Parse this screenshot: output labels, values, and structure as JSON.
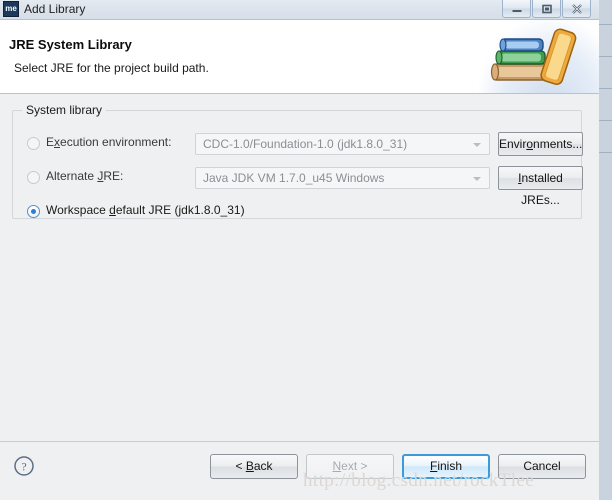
{
  "window": {
    "title": "Add Library",
    "icon_label": "me",
    "icon_name": "eclipse-app-icon",
    "controls": [
      {
        "name": "minimize-button",
        "icon": "minimize-icon",
        "label": "Minimize"
      },
      {
        "name": "maximize-button",
        "icon": "maximize-icon",
        "label": "Maximize"
      },
      {
        "name": "close-button",
        "icon": "close-icon",
        "label": "Close"
      }
    ]
  },
  "header": {
    "title": "JRE System Library",
    "subtitle": "Select JRE for the project build path.",
    "banner_icon": "stacked-books-icon"
  },
  "group": {
    "legend": "System library",
    "options": [
      {
        "id": "execution-environment",
        "label_pre": "E",
        "label_mnemonic": "x",
        "label_post": "ecution environment:",
        "label_full": "Execution environment:",
        "selected": false,
        "disabled": true,
        "combo": {
          "value": "CDC-1.0/Foundation-1.0 (jdk1.8.0_31)",
          "name": "execution-environment-combobox"
        },
        "button": {
          "label_pre": "Envir",
          "label_mnemonic": "o",
          "label_post": "nments...",
          "label_full": "Environments...",
          "name": "environments-button"
        }
      },
      {
        "id": "alternate-jre",
        "label_pre": "Alternate ",
        "label_mnemonic": "J",
        "label_post": "RE:",
        "label_full": "Alternate JRE:",
        "selected": false,
        "disabled": true,
        "combo": {
          "value": "Java JDK VM 1.7.0_u45 Windows",
          "name": "alternate-jre-combobox"
        },
        "button": {
          "label_pre": "",
          "label_mnemonic": "I",
          "label_post": "nstalled JREs...",
          "label_full": "Installed JREs...",
          "name": "installed-jres-button"
        }
      },
      {
        "id": "workspace-default-jre",
        "label_pre": "Workspace ",
        "label_mnemonic": "d",
        "label_post": "efault JRE (jdk1.8.0_31)",
        "label_full": "Workspace default JRE (jdk1.8.0_31)",
        "selected": true,
        "disabled": false
      }
    ]
  },
  "footer": {
    "help_icon": "help-question-icon",
    "buttons": [
      {
        "name": "back-button",
        "pre": "< ",
        "mnemonic": "B",
        "post": "ack",
        "full": "< Back",
        "state": "enabled"
      },
      {
        "name": "next-button",
        "pre": "",
        "mnemonic": "N",
        "post": "ext >",
        "full": "Next >",
        "state": "disabled"
      },
      {
        "name": "finish-button",
        "pre": "",
        "mnemonic": "F",
        "post": "inish",
        "full": "Finish",
        "state": "default"
      },
      {
        "name": "cancel-button",
        "pre": "Cancel",
        "mnemonic": "",
        "post": "",
        "full": "Cancel",
        "state": "enabled"
      }
    ]
  },
  "watermark": {
    "text": "http://blog.csdn.net/rockTlee"
  },
  "colors": {
    "accent": "#3c9ada",
    "radio_dot": "#2f7fd0",
    "title_icon_bg": "#1b3a5c",
    "header_bg": "#ffffff",
    "body_bg": "#eff0f1"
  }
}
